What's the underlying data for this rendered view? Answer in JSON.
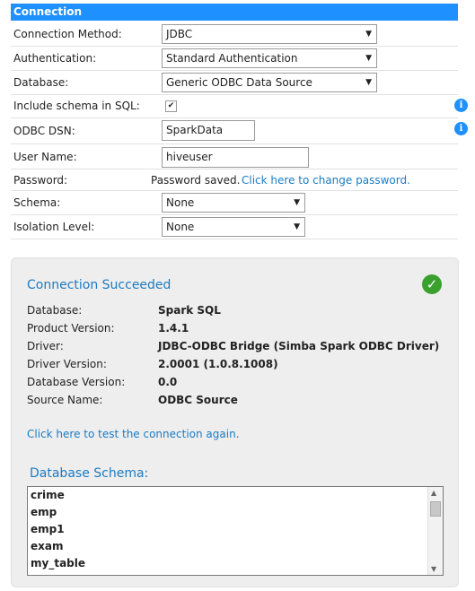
{
  "section_title": "Connection",
  "form": {
    "connection_method": {
      "label": "Connection Method:",
      "value": "JDBC"
    },
    "authentication": {
      "label": "Authentication:",
      "value": "Standard Authentication"
    },
    "database": {
      "label": "Database:",
      "value": "Generic ODBC Data Source"
    },
    "include_schema": {
      "label": "Include schema in SQL:",
      "checked": true
    },
    "odbc_dsn": {
      "label": "ODBC DSN:",
      "value": "SparkData"
    },
    "user_name": {
      "label": "User Name:",
      "value": "hiveuser"
    },
    "password": {
      "label": "Password:",
      "status": "Password saved.",
      "change_link": "Click here to change password."
    },
    "schema": {
      "label": "Schema:",
      "value": "None"
    },
    "isolation_level": {
      "label": "Isolation Level:",
      "value": "None"
    }
  },
  "result": {
    "title": "Connection Succeeded",
    "details": [
      {
        "label": "Database:",
        "value": "Spark SQL"
      },
      {
        "label": "Product Version:",
        "value": "1.4.1"
      },
      {
        "label": "Driver:",
        "value": "JDBC-ODBC Bridge (Simba Spark ODBC Driver)"
      },
      {
        "label": "Driver Version:",
        "value": "2.0001 (1.0.8.1008)"
      },
      {
        "label": "Database Version:",
        "value": "0.0"
      },
      {
        "label": "Source Name:",
        "value": "ODBC Source"
      }
    ],
    "test_again_link": "Click here to test the connection again.",
    "schema_title": "Database Schema:",
    "schema_items": [
      "crime",
      "emp",
      "emp1",
      "exam",
      "my_table"
    ]
  },
  "colors": {
    "accent": "#1e90ff",
    "link": "#1a7bc4",
    "success": "#3aa02e"
  }
}
